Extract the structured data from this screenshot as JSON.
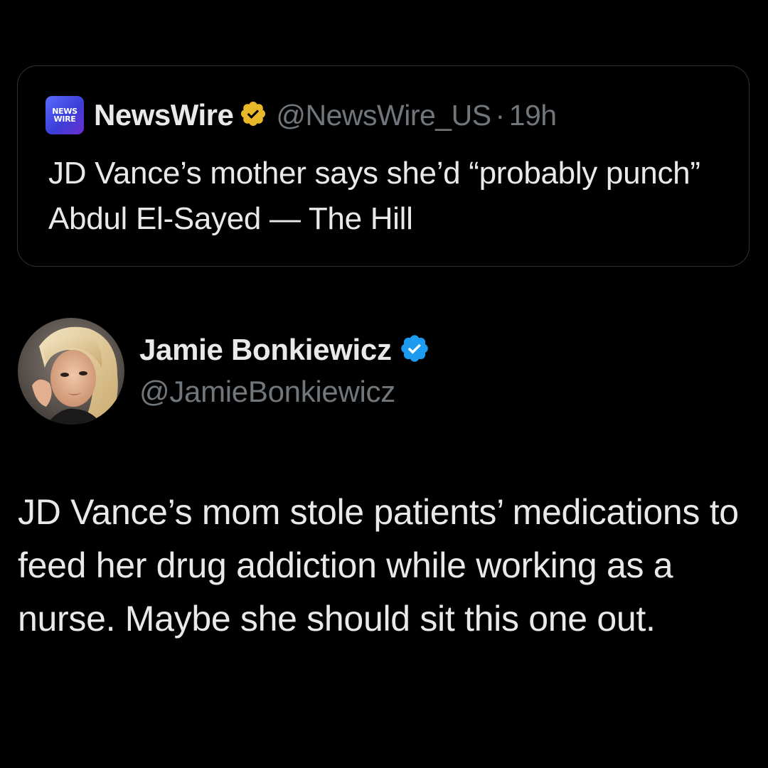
{
  "quoted_tweet": {
    "logo_text_line1": "NEWS",
    "logo_text_line2": "WIRE",
    "display_name": "NewsWire",
    "handle": "@NewsWire_US",
    "separator": "·",
    "time": "19h",
    "text": "JD Vance’s mother says she’d “probably punch” Abdul El-Sayed — The Hill",
    "badge_icon": "verified-gold-badge-icon",
    "badge_color": "#e8b829"
  },
  "tweet": {
    "author_name": "Jamie Bonkiewicz",
    "author_handle": "@JamieBonkiewicz",
    "badge_icon": "verified-blue-badge-icon",
    "badge_color": "#1d9bf0",
    "avatar_icon": "profile-photo",
    "text": "JD Vance’s mom stole patients’ medications to feed her drug addiction while working as a nurse. Maybe she should sit this one out."
  },
  "colors": {
    "background": "#000000",
    "primary_text": "#e7e9ea",
    "secondary_text": "#71767b",
    "card_border": "#2f3336"
  }
}
